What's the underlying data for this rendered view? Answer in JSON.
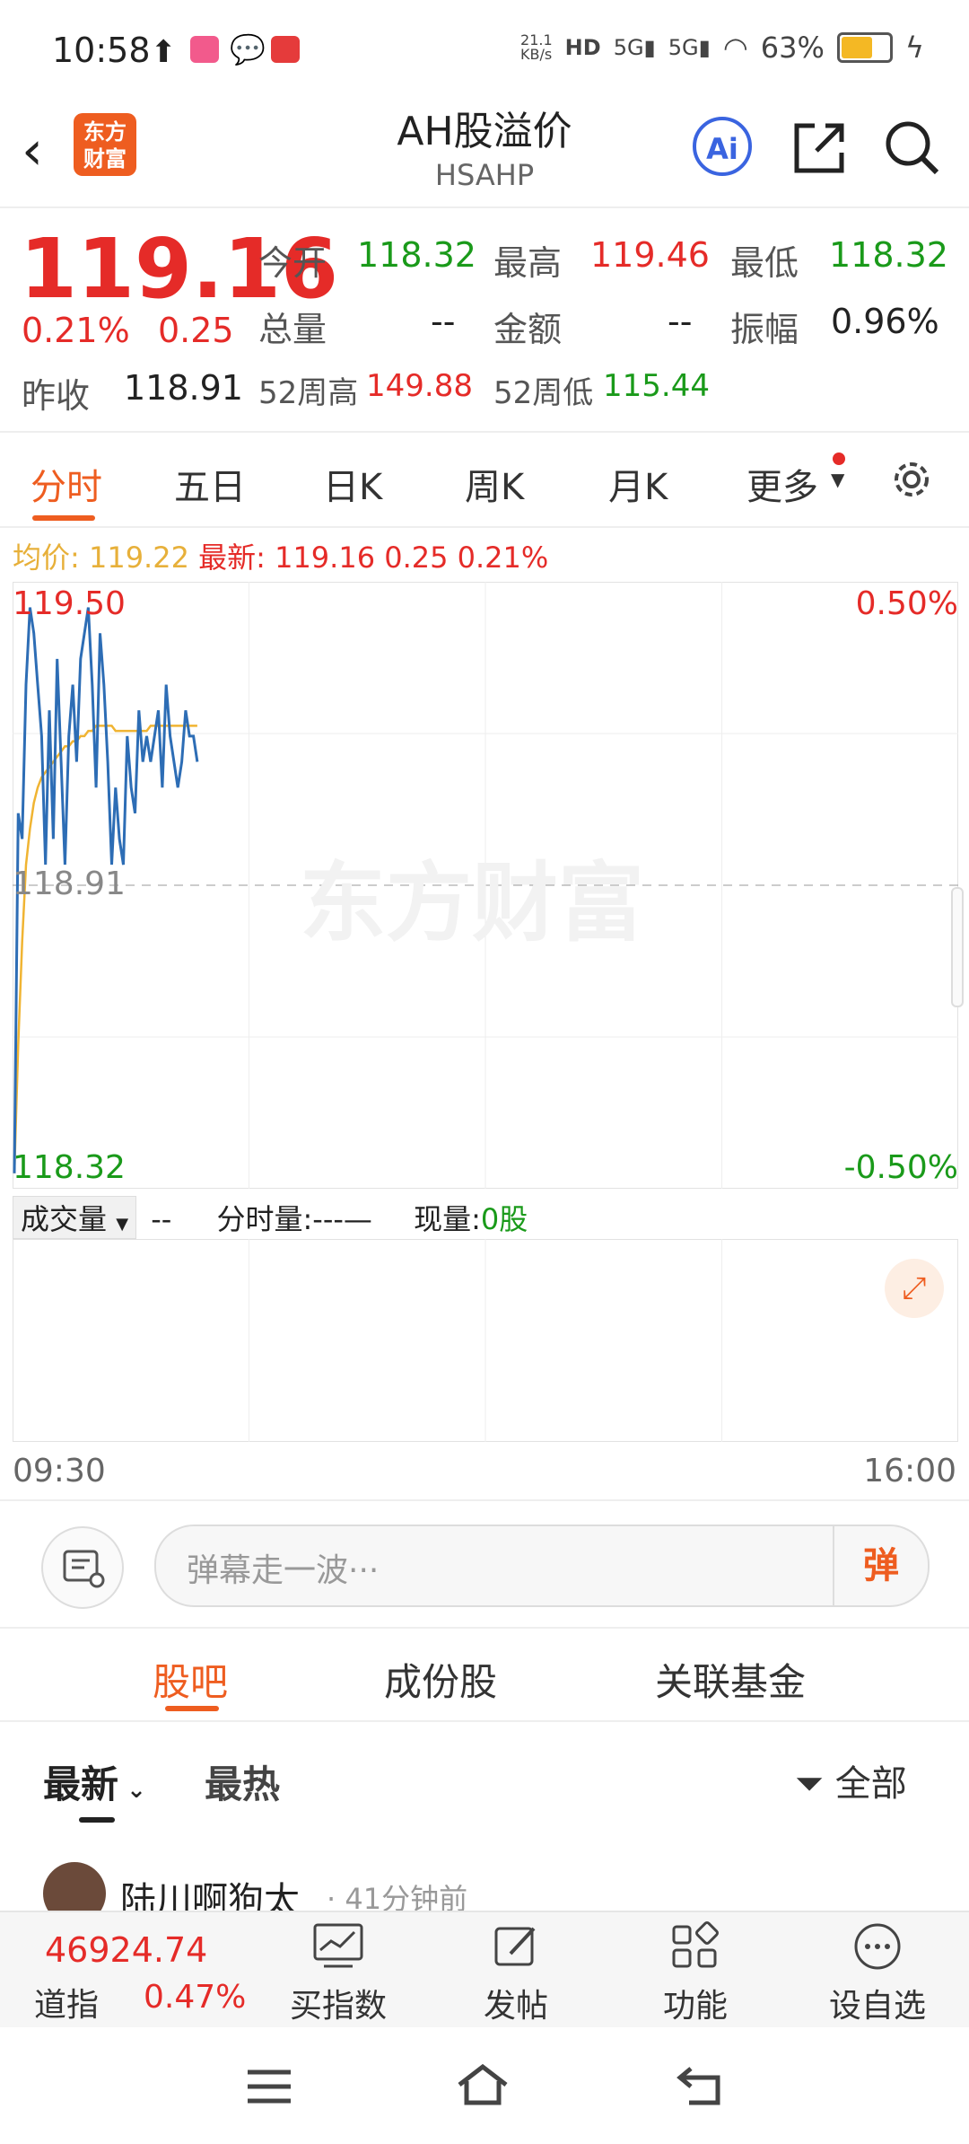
{
  "status": {
    "time": "10:58",
    "speed": "21.1\nKB/s",
    "battery": "63%",
    "battery_level": 0.63
  },
  "header": {
    "title": "AH股溢价",
    "subtitle": "HSAHP",
    "logo_line1": "东方",
    "logo_line2": "财富",
    "ai_label": "Ai"
  },
  "quote": {
    "price": "119.16",
    "change_pct": "0.21%",
    "change": "0.25",
    "open_label": "今开",
    "open": "118.32",
    "high_label": "最高",
    "high": "119.46",
    "low_label": "最低",
    "low": "118.32",
    "vol_label": "总量",
    "vol": "--",
    "amount_label": "金额",
    "amount": "--",
    "amp_label": "振幅",
    "amp": "0.96%",
    "prev_label": "昨收",
    "prev": "118.91",
    "w52h_label": "52周高",
    "w52h": "149.88",
    "w52l_label": "52周低",
    "w52l": "115.44"
  },
  "tabs": [
    "分时",
    "五日",
    "日K",
    "周K",
    "月K",
    "更多"
  ],
  "chart_info": {
    "avg_label": "均价:",
    "avg": "119.22",
    "latest_label": "最新:",
    "latest": "119.16",
    "chg": "0.25",
    "chg_pct": "0.21%"
  },
  "chart_labels": {
    "top_left": "119.50",
    "top_right": "0.50%",
    "mid": "118.91",
    "bottom_left": "118.32",
    "bottom_right": "-0.50%",
    "watermark": "东方财富",
    "time_start": "09:30",
    "time_end": "16:00"
  },
  "chart_data": {
    "type": "line",
    "ylim": [
      118.32,
      119.5
    ],
    "baseline": 118.91,
    "x_range": [
      "09:30",
      "16:00"
    ],
    "series": [
      {
        "color": "#2d6db5",
        "values": [
          118.35,
          119.05,
          119.0,
          119.3,
          119.45,
          119.4,
          119.3,
          119.2,
          118.95,
          119.25,
          119.0,
          119.35,
          119.15,
          118.95,
          119.2,
          119.3,
          119.15,
          119.35,
          119.4,
          119.45,
          119.3,
          119.1,
          119.4,
          119.3,
          119.15,
          118.95,
          119.1,
          119.0,
          118.95,
          119.2,
          119.1,
          119.05,
          119.25,
          119.15,
          119.2,
          119.15,
          119.2,
          119.25,
          119.1,
          119.3,
          119.2,
          119.15,
          119.1,
          119.15,
          119.25,
          119.2,
          119.2,
          119.15
        ]
      },
      {
        "color": "#f0b432",
        "values": [
          118.35,
          118.6,
          118.8,
          118.95,
          119.02,
          119.07,
          119.1,
          119.12,
          119.13,
          119.14,
          119.15,
          119.16,
          119.17,
          119.18,
          119.18,
          119.19,
          119.19,
          119.2,
          119.2,
          119.21,
          119.21,
          119.22,
          119.22,
          119.22,
          119.22,
          119.22,
          119.21,
          119.21,
          119.21,
          119.21,
          119.21,
          119.21,
          119.21,
          119.21,
          119.21,
          119.22,
          119.22,
          119.22,
          119.22,
          119.22,
          119.22,
          119.22,
          119.22,
          119.22,
          119.22,
          119.22,
          119.22,
          119.22
        ]
      }
    ]
  },
  "volume": {
    "type_label": "成交量",
    "type_value": "--",
    "minute_label": "分时量:",
    "minute_value": "---—",
    "now_label": "现量:",
    "now_value": "0股"
  },
  "danmu": {
    "placeholder": "弹幕走一波···",
    "btn": "弹"
  },
  "section_tabs": [
    "股吧",
    "成份股",
    "关联基金"
  ],
  "filter": {
    "latest": "最新",
    "hot": "最热",
    "all": "全部"
  },
  "post": {
    "user": "陆川啊狗太",
    "time": "· 41分钟前"
  },
  "bottom": {
    "index_value": "46924.74",
    "index_name": "道指",
    "index_chg": "0.47%",
    "buy": "买指数",
    "post": "发帖",
    "func": "功能",
    "fav": "设自选"
  }
}
